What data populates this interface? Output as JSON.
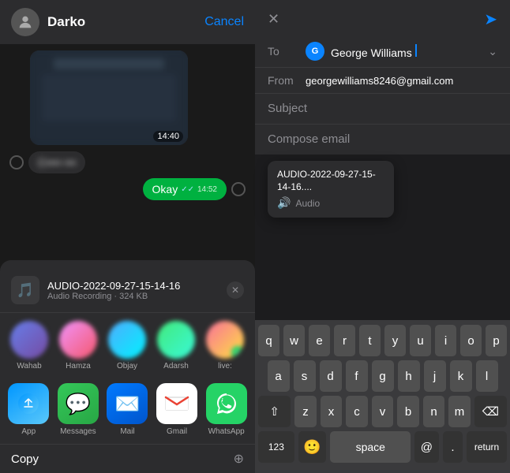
{
  "left": {
    "header": {
      "name": "Darko",
      "cancel": "Cancel"
    },
    "messages": {
      "timestamp1": "14:40",
      "text_blurred": "C••• •••",
      "okay_text": "Okay",
      "timestamp2": "14:52"
    },
    "attachment": {
      "name": "AUDIO-2022-09-27-15-14-16",
      "meta": "Audio Recording · 324 KB"
    },
    "contacts": [
      {
        "name": "Wahab",
        "class": "ca1"
      },
      {
        "name": "Hamza",
        "class": "ca2"
      },
      {
        "name": "Objay",
        "class": "ca3"
      },
      {
        "name": "Adarsh",
        "class": "ca4"
      },
      {
        "name": "live:",
        "class": "ca5"
      }
    ],
    "apps": [
      {
        "name": "App",
        "icon": "📡",
        "bg": "airdrop"
      },
      {
        "name": "Messages",
        "icon": "💬",
        "bg": "messages"
      },
      {
        "name": "Mail",
        "icon": "✉️",
        "bg": "mail"
      },
      {
        "name": "Gmail",
        "icon": "M",
        "bg": "gmail"
      },
      {
        "name": "WhatsApp",
        "icon": "📱",
        "bg": "whatsapp"
      }
    ],
    "copy_label": "Copy"
  },
  "right": {
    "email": {
      "to_label": "To",
      "to_initial": "G",
      "to_name": "George Williams",
      "from_label": "From",
      "from_email": "georgewilliams8246@gmail.com",
      "subject_placeholder": "Subject",
      "compose_placeholder": "Compose email"
    },
    "attachment_preview": {
      "name": "AUDIO-2022-09-27-15-14-16....",
      "type": "Audio"
    },
    "keyboard": {
      "rows": [
        [
          "q",
          "w",
          "e",
          "r",
          "t",
          "y",
          "u",
          "i",
          "o",
          "p"
        ],
        [
          "a",
          "s",
          "d",
          "f",
          "g",
          "h",
          "j",
          "k",
          "l"
        ],
        [
          "z",
          "x",
          "c",
          "v",
          "b",
          "n",
          "m"
        ],
        [
          "123",
          "😊",
          "space",
          "@",
          ".",
          "return"
        ]
      ]
    }
  }
}
